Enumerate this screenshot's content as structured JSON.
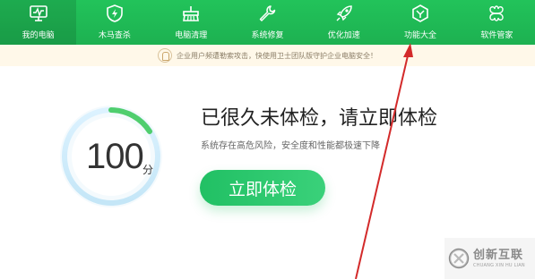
{
  "nav": {
    "items": [
      {
        "label": "我的电脑",
        "icon": "monitor-icon",
        "active": true
      },
      {
        "label": "木马查杀",
        "icon": "shield-bolt-icon",
        "active": false
      },
      {
        "label": "电脑清理",
        "icon": "broom-icon",
        "active": false
      },
      {
        "label": "系统修复",
        "icon": "wrench-icon",
        "active": false
      },
      {
        "label": "优化加速",
        "icon": "rocket-icon",
        "active": false
      },
      {
        "label": "功能大全",
        "icon": "grid-shield-icon",
        "active": false
      },
      {
        "label": "软件管家",
        "icon": "clover-icon",
        "active": false
      }
    ]
  },
  "notice": {
    "text": "企业用户频遭勒索攻击，快使用卫士团队版守护企业电脑安全！"
  },
  "score": {
    "value": "100",
    "unit": "分"
  },
  "main": {
    "headline": "已很久未体检，请立即体检",
    "subtext": "系统存在高危风险，安全度和性能都极速下降",
    "check_button": "立即体检"
  },
  "watermark": {
    "cn": "创新互联",
    "en": "CHUANG XIN HU LIAN"
  },
  "colors": {
    "nav_green": "#1fb855",
    "button_green": "#21c064",
    "ring_green": "#4fce6e",
    "ring_blue": "#b9ddf2",
    "arrow_red": "#d32a2a",
    "notice_bg": "#fff8e9"
  }
}
